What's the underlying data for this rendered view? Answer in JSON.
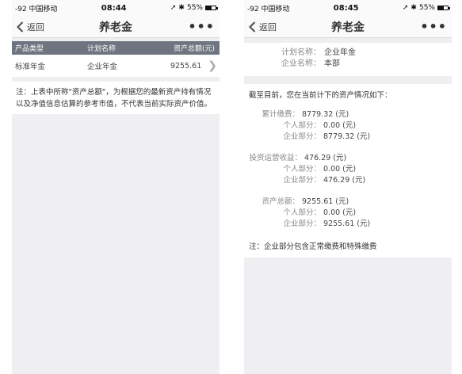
{
  "left": {
    "status": {
      "carrier": "-92 中国移动",
      "time": "08:44",
      "battery": "55%"
    },
    "nav": {
      "back_label": "返回",
      "title": "养老金",
      "more_label": "•••"
    },
    "table": {
      "headers": [
        "产品类型",
        "计划名称",
        "资产总额(元)"
      ],
      "rows": [
        [
          "标准年金",
          "企业年金",
          "9255.61"
        ]
      ]
    },
    "note": "注：上表中所称\"资产总额\"，为根据您的最新资产持有情况以及净值信息估算的参考市值，不代表当前实际资产价值。"
  },
  "right": {
    "status": {
      "carrier": "-92 中国移动",
      "time": "08:45",
      "battery": "55%"
    },
    "nav": {
      "back_label": "返回",
      "title": "养老金",
      "more_label": "•••"
    },
    "info": {
      "plan_label": "计划名称：",
      "plan_value": "企业年金",
      "company_label": "企业名称：",
      "company_value": "本部"
    },
    "summary": {
      "intro": "截至目前，您在当前计下的资产情况如下：",
      "contrib": {
        "label": "累计缴费：",
        "value": "8779.32 (元)",
        "personal_label": "个人部分：",
        "personal_value": "0.00 (元)",
        "company_label": "企业部分：",
        "company_value": "8779.32 (元)"
      },
      "ops": {
        "label": "投资运营收益：",
        "value": "476.29 (元)",
        "personal_label": "个人部分：",
        "personal_value": "0.00 (元)",
        "company_label": "企业部分：",
        "company_value": "476.29 (元)"
      },
      "total": {
        "label": "资产总额：",
        "value": "9255.61 (元)",
        "personal_label": "个人部分：",
        "personal_value": "0.00 (元)",
        "company_label": "企业部分：",
        "company_value": "9255.61 (元)"
      },
      "note": "注：企业部分包含正常缴费和特殊缴费"
    }
  },
  "colors": {
    "header_bg": "#6e7580",
    "page_bg": "#efeff1",
    "chevron": "#aaaaaa"
  }
}
